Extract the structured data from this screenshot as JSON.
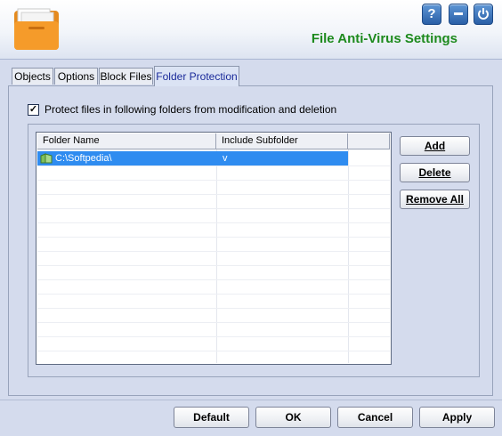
{
  "window": {
    "title": "File Anti-Virus Settings",
    "title_color": "#1d8a1d"
  },
  "header_buttons": [
    {
      "icon": "help-icon",
      "label": "?"
    },
    {
      "icon": "minimize-icon"
    },
    {
      "icon": "power-icon"
    }
  ],
  "tabs": [
    {
      "label": "Objects",
      "active": false
    },
    {
      "label": "Options",
      "active": false
    },
    {
      "label": "Block Files",
      "active": false
    },
    {
      "label": "Folder Protection",
      "active": true
    }
  ],
  "protection": {
    "checkbox_label": "Protect files in following folders from modification and deletion",
    "checked": true
  },
  "folder_list": {
    "columns": [
      "Folder Name",
      "Include Subfolder"
    ],
    "rows": [
      {
        "folder": "C:\\Softpedia\\",
        "include_subfolder": "v",
        "selected": true
      }
    ]
  },
  "side_buttons": {
    "add": "Add",
    "delete": "Delete",
    "remove_all": "Remove All"
  },
  "footer_buttons": {
    "default": "Default",
    "ok": "OK",
    "cancel": "Cancel",
    "apply": "Apply"
  },
  "colors": {
    "selection": "#2f8cf0",
    "background": "#d4dbed",
    "active_tab_text": "#1a2a9a"
  }
}
